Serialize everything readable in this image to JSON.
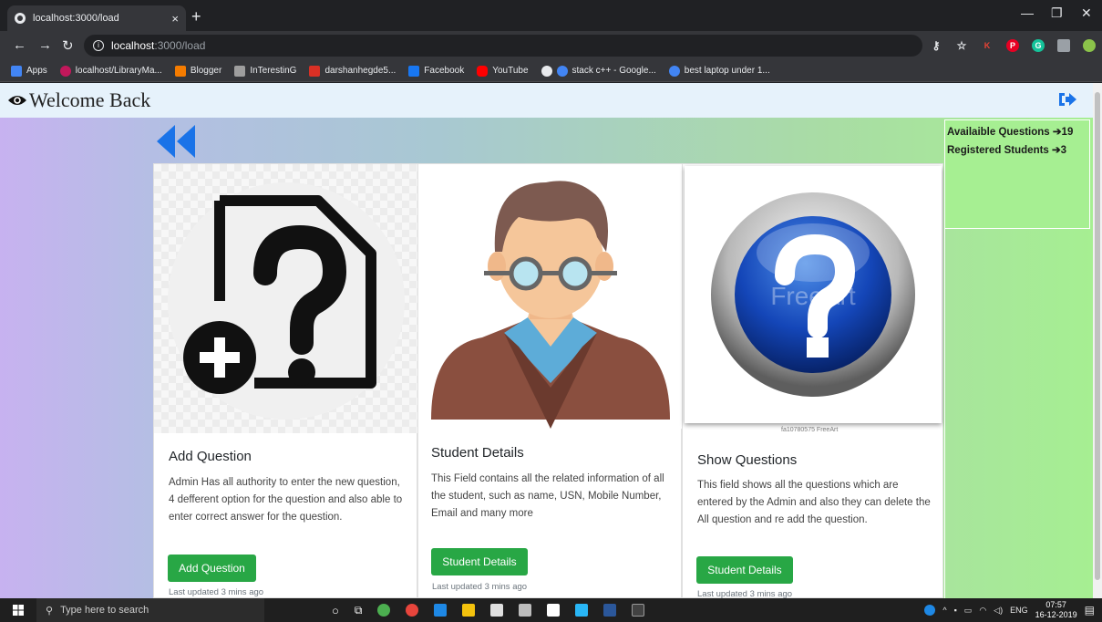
{
  "browser": {
    "tab_title": "localhost:3000/load",
    "url_host": "localhost",
    "url_path": ":3000/load",
    "bookmarks": [
      {
        "label": "Apps",
        "color": "#4285f4"
      },
      {
        "label": "localhost/LibraryMa...",
        "color": "#c2185b"
      },
      {
        "label": "Blogger",
        "color": "#f57c00"
      },
      {
        "label": "InTerestinG",
        "color": "#9e9e9e"
      },
      {
        "label": "darshanhegde5...",
        "color": "#d93025"
      },
      {
        "label": "Facebook",
        "color": "#1877f2"
      },
      {
        "label": "YouTube",
        "color": "#ff0000"
      },
      {
        "label": "stack c++ - Google...",
        "color": "#e8eaed"
      },
      {
        "label": "best laptop under 1...",
        "color": "#e8eaed"
      }
    ]
  },
  "header": {
    "title": "Welcome Back",
    "logout_icon": "sign-out-icon"
  },
  "stats": {
    "questions_label": "Availaible Questions",
    "questions_count": "19",
    "students_label": "Registered Students",
    "students_count": "3"
  },
  "cards": [
    {
      "title": "Add Question",
      "text": "Admin Has all authority to enter the new question, 4 defferent option for the question and also able to enter correct answer for the question.",
      "button": "Add Question",
      "updated": "Last updated 3 mins ago"
    },
    {
      "title": "Student Details",
      "text": "This Field contains all the related information of all the student, such as name, USN, Mobile Number, Email and many more",
      "button": "Student Details",
      "updated": "Last updated 3 mins ago"
    },
    {
      "title": "Show Questions",
      "text": "This field shows all the questions which are entered by the Admin and also they can delete the All question and re add the question.",
      "button": "Student Details",
      "updated": "Last updated 3 mins ago",
      "image_caption": "fa10780575 FreeArt"
    }
  ],
  "taskbar": {
    "search_placeholder": "Type here to search",
    "lang": "ENG",
    "time": "07:57",
    "date": "16-12-2019"
  },
  "colors": {
    "accent_blue": "#1a73e8",
    "button_green": "#28a745"
  }
}
